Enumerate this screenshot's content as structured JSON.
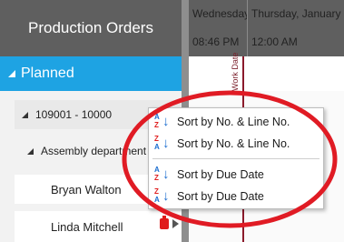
{
  "header": {
    "title": "Production Orders",
    "columns": [
      {
        "date": "Wednesday",
        "time": "08:46 PM"
      },
      {
        "date": "Thursday, January",
        "time": "12:00 AM"
      }
    ]
  },
  "planned": {
    "label": "Planned"
  },
  "gantt": {
    "work_date_label": "Work Date"
  },
  "tree": {
    "order": "109001 - 10000",
    "department": "Assembly department",
    "resources": [
      "Bryan Walton",
      "Linda Mitchell"
    ]
  },
  "context_menu": {
    "items": [
      {
        "label": "Sort by No. & Line No.",
        "icon": "sort-ascending-icon"
      },
      {
        "label": "Sort by No. & Line No.",
        "icon": "sort-descending-icon"
      },
      {
        "label": "Sort by Due Date",
        "icon": "sort-ascending-icon"
      },
      {
        "label": "Sort by Due Date",
        "icon": "sort-descending-icon"
      }
    ]
  },
  "colors": {
    "header_bg": "#5f5f5f",
    "accent": "#1ea3e3",
    "work_date_line": "#8b1a2b",
    "annotation": "#e01b24"
  }
}
